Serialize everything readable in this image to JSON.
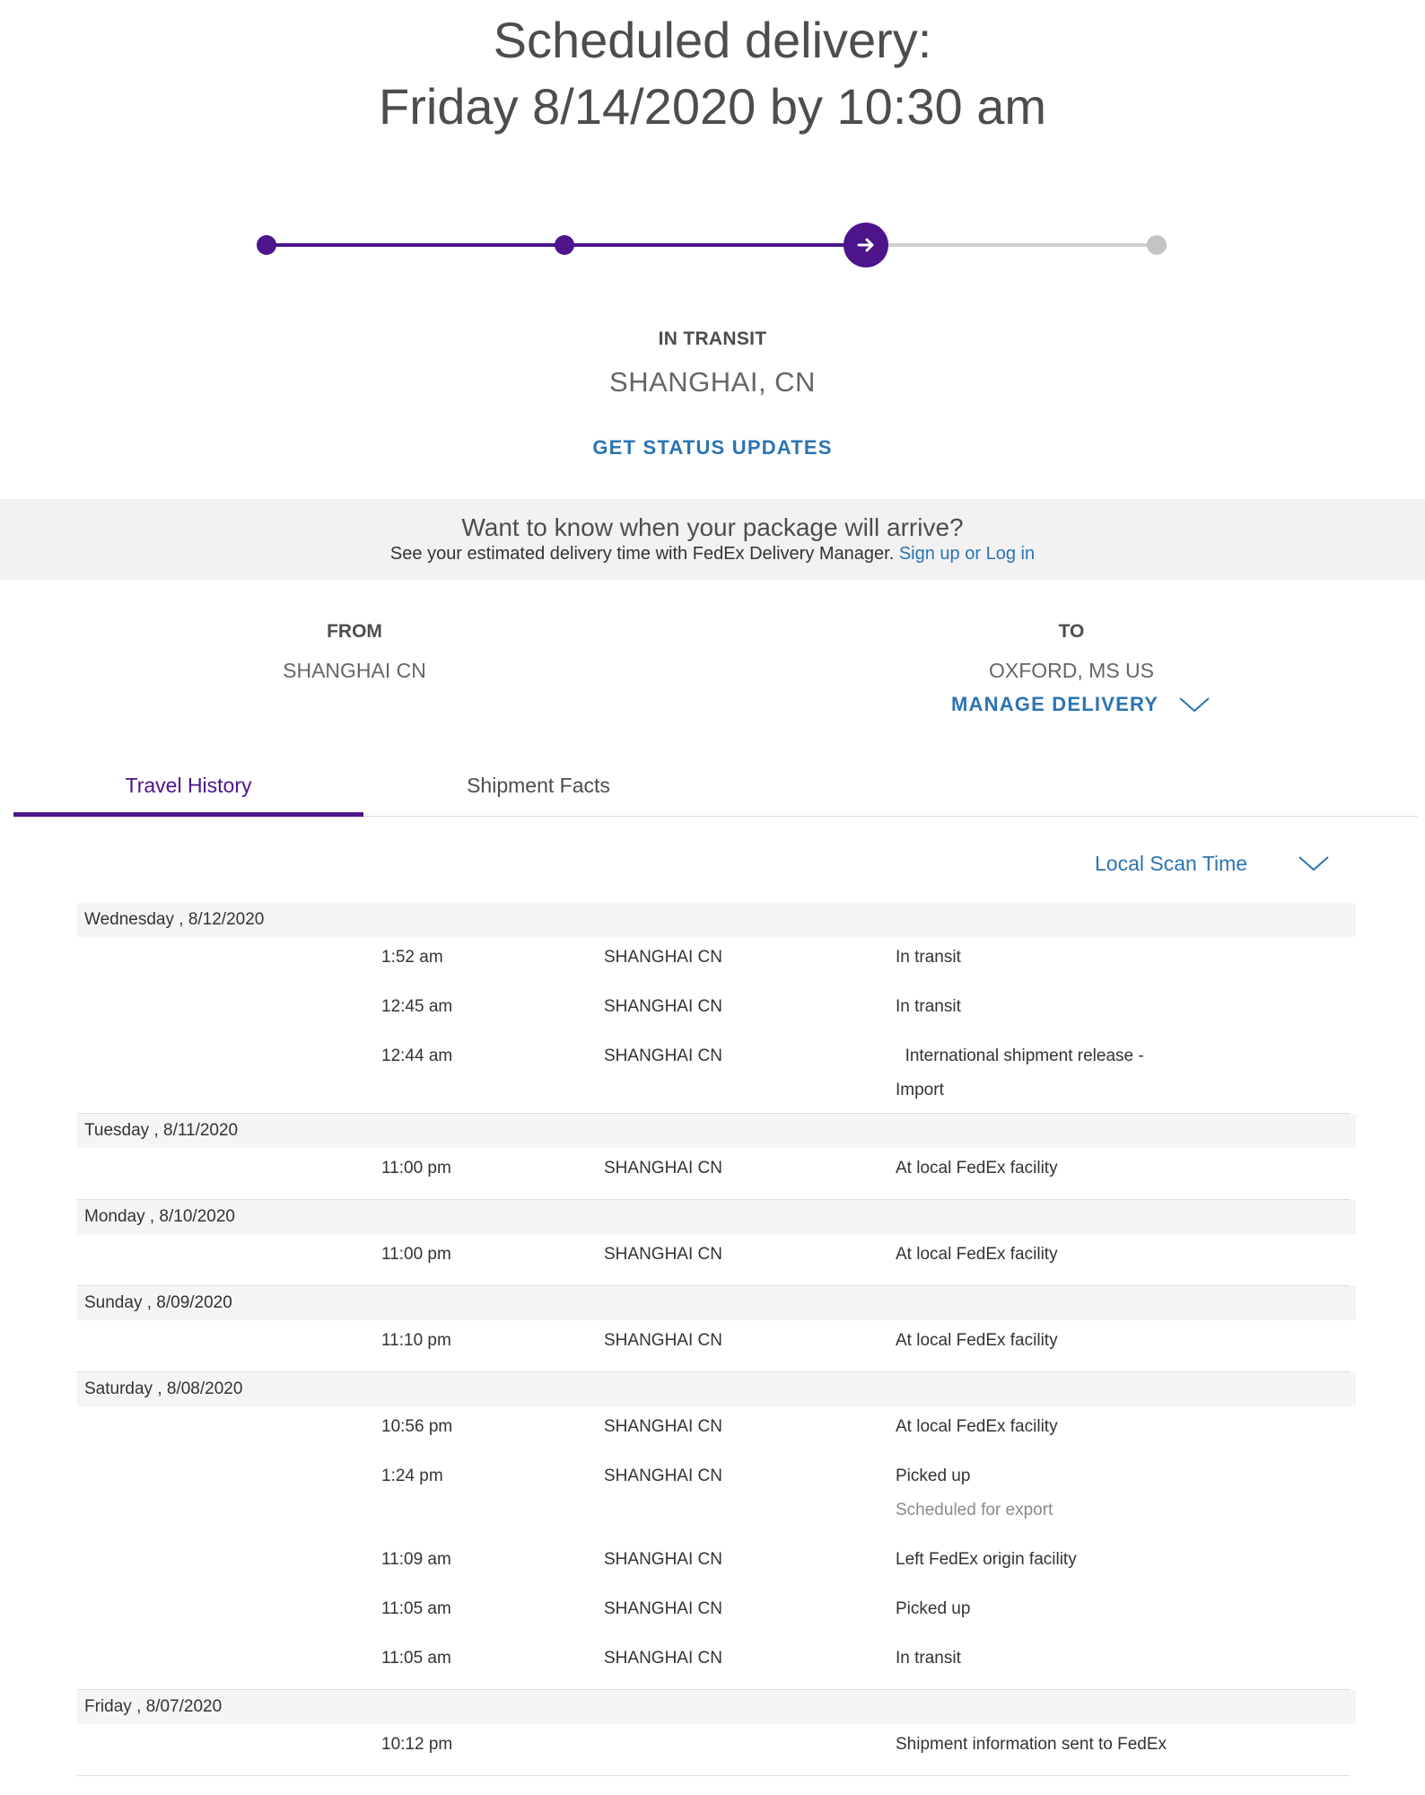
{
  "header": {
    "line1": "Scheduled delivery:",
    "line2": "Friday 8/14/2020 by 10:30 am"
  },
  "tracker": {
    "steps_total": 4,
    "current_step": 3,
    "colors": {
      "done": "#4d148c",
      "pending": "#c4c4c4"
    }
  },
  "status": {
    "label": "IN TRANSIT",
    "location": "SHANGHAI, CN",
    "updates_link": "GET STATUS UPDATES"
  },
  "promo": {
    "title": "Want to know when your package will arrive?",
    "text": "See your estimated delivery time with FedEx Delivery Manager.",
    "link": "Sign up or Log in"
  },
  "addresses": {
    "from_label": "FROM",
    "from_value": "SHANGHAI CN",
    "to_label": "TO",
    "to_value": "OXFORD, MS US",
    "manage_label": "MANAGE DELIVERY"
  },
  "tabs": [
    {
      "label": "Travel History",
      "active": true
    },
    {
      "label": "Shipment Facts",
      "active": false
    }
  ],
  "scan_time_label": "Local Scan Time",
  "history": [
    {
      "date": "Wednesday , 8/12/2020",
      "events": [
        {
          "time": "1:52 am",
          "location": "SHANGHAI CN",
          "activity": "In transit",
          "note": ""
        },
        {
          "time": "12:45 am",
          "location": "SHANGHAI CN",
          "activity": "In transit",
          "note": ""
        },
        {
          "time": "12:44 am",
          "location": "SHANGHAI CN",
          "activity": "  International shipment release - Import",
          "note": ""
        }
      ]
    },
    {
      "date": "Tuesday , 8/11/2020",
      "events": [
        {
          "time": "11:00 pm",
          "location": "SHANGHAI CN",
          "activity": "At local FedEx facility",
          "note": ""
        }
      ]
    },
    {
      "date": "Monday , 8/10/2020",
      "events": [
        {
          "time": "11:00 pm",
          "location": "SHANGHAI CN",
          "activity": "At local FedEx facility",
          "note": ""
        }
      ]
    },
    {
      "date": "Sunday , 8/09/2020",
      "events": [
        {
          "time": "11:10 pm",
          "location": "SHANGHAI CN",
          "activity": "At local FedEx facility",
          "note": ""
        }
      ]
    },
    {
      "date": "Saturday , 8/08/2020",
      "events": [
        {
          "time": "10:56 pm",
          "location": "SHANGHAI CN",
          "activity": "At local FedEx facility",
          "note": ""
        },
        {
          "time": "1:24 pm",
          "location": "SHANGHAI CN",
          "activity": "Picked up",
          "note": "Scheduled for export"
        },
        {
          "time": "11:09 am",
          "location": "SHANGHAI CN",
          "activity": "Left FedEx origin facility",
          "note": ""
        },
        {
          "time": "11:05 am",
          "location": "SHANGHAI CN",
          "activity": "Picked up",
          "note": ""
        },
        {
          "time": "11:05 am",
          "location": "SHANGHAI CN",
          "activity": "In transit",
          "note": ""
        }
      ]
    },
    {
      "date": "Friday , 8/07/2020",
      "events": [
        {
          "time": "10:12 pm",
          "location": "",
          "activity": "Shipment information sent to FedEx",
          "note": ""
        }
      ]
    }
  ]
}
